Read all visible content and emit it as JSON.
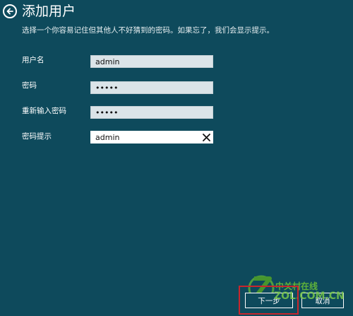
{
  "header": {
    "title": "添加用户",
    "subtitle": "选择一个你容易记住但其他人不好猜到的密码。如果忘了，我们会显示提示。"
  },
  "form": {
    "username": {
      "label": "用户名",
      "value": "admin"
    },
    "password": {
      "label": "密码",
      "value": "•••••"
    },
    "confirm_password": {
      "label": "重新输入密码",
      "value": "•••••"
    },
    "hint": {
      "label": "密码提示",
      "value": "admin"
    }
  },
  "buttons": {
    "next_label": "下一步",
    "cancel_label": "取消"
  },
  "watermark": {
    "line1": "中关村在线",
    "line2": "ZOL.COM.CN"
  },
  "colors": {
    "background": "#0e4a5c",
    "highlight": "#c8262c",
    "watermark_green": "#5fb23a"
  },
  "icons": {
    "back": "back-arrow-icon",
    "clear": "close-icon"
  }
}
